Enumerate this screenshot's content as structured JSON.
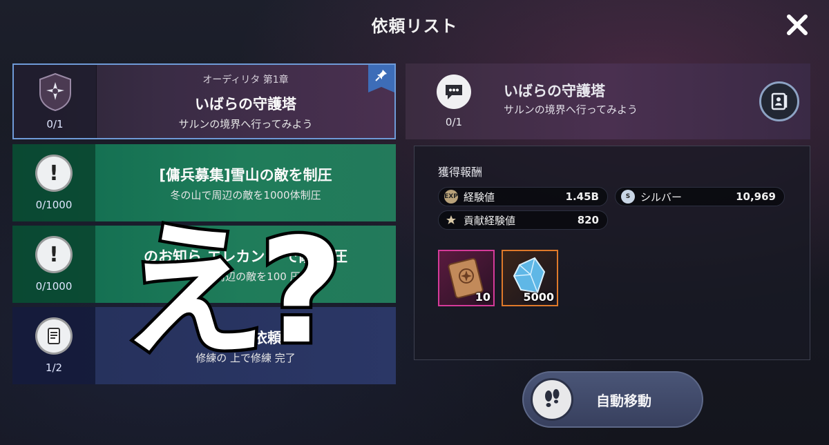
{
  "header": {
    "title": "依頼リスト"
  },
  "quests": [
    {
      "chapter": "オーディリタ 第1章",
      "title": "いばらの守護塔",
      "subtitle": "サルンの境界へ行ってみよう",
      "progress": "0/1"
    },
    {
      "title": "[傭兵募集]雪山の敵を制圧",
      "subtitle": "冬の山で周辺の敵を1000体制圧",
      "progress": "0/1000"
    },
    {
      "title": "のお知ら エレカンの で敵 制圧",
      "subtitle": "シ で周辺の敵を100 圧",
      "progress": "0/1000"
    },
    {
      "title": "義兄弟依頼",
      "subtitle": "修練の 上で修練 完了",
      "progress": "1/2"
    }
  ],
  "overlay": {
    "text": "え?"
  },
  "detail": {
    "title": "いばらの守護塔",
    "subtitle": "サルンの境界へ行ってみよう",
    "progress": "0/1",
    "reward_label": "獲得報酬",
    "rewards": [
      {
        "name": "経験値",
        "value": "1.45B",
        "icon": "exp-coin-icon",
        "icon_text": "EXP"
      },
      {
        "name": "シルバー",
        "value": "10,969",
        "icon": "silver-coin-icon",
        "icon_text": "S"
      },
      {
        "name": "貢献経験値",
        "value": "820",
        "icon": "contribution-icon",
        "icon_text": ""
      }
    ],
    "items": [
      {
        "icon": "scroll-item-icon",
        "count": "10",
        "border": "#d63a9a"
      },
      {
        "icon": "crystal-item-icon",
        "count": "5000",
        "border": "#e07a2a"
      }
    ]
  },
  "auto_move": {
    "label": "自動移動"
  }
}
